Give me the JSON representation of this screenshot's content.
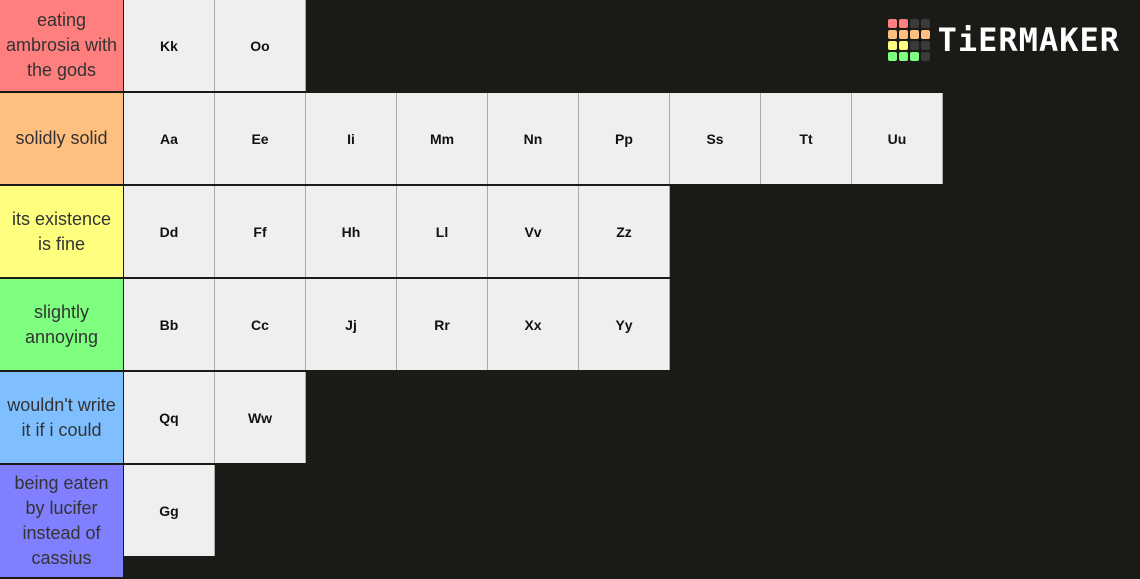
{
  "brand": {
    "name": "TiERMAKER",
    "grid_colors": [
      "#ff7f7f",
      "#ff7f7f",
      "#3a3a3a",
      "#3a3a3a",
      "#ffbf7f",
      "#ffbf7f",
      "#ffbf7f",
      "#ffbf7f",
      "#ffff7f",
      "#ffff7f",
      "#3a3a3a",
      "#3a3a3a",
      "#7fff7f",
      "#7fff7f",
      "#7fff7f",
      "#3a3a3a"
    ]
  },
  "tiers": [
    {
      "label": "eating ambrosia with the gods",
      "color": "#ff7f7f",
      "items": [
        "Kk",
        "Oo"
      ]
    },
    {
      "label": "solidly solid",
      "color": "#ffbf7f",
      "items": [
        "Aa",
        "Ee",
        "Ii",
        "Mm",
        "Nn",
        "Pp",
        "Ss",
        "Tt",
        "Uu"
      ]
    },
    {
      "label": "its existence is fine",
      "color": "#ffff7f",
      "items": [
        "Dd",
        "Ff",
        "Hh",
        "Ll",
        "Vv",
        "Zz"
      ]
    },
    {
      "label": "slightly annoying",
      "color": "#7fff7f",
      "items": [
        "Bb",
        "Cc",
        "Jj",
        "Rr",
        "Xx",
        "Yy"
      ]
    },
    {
      "label": "wouldn't write it if i could",
      "color": "#7fbfff",
      "items": [
        "Qq",
        "Ww"
      ]
    },
    {
      "label": "being eaten by lucifer instead of cassius",
      "color": "#7f7fff",
      "items": [
        "Gg"
      ]
    }
  ]
}
